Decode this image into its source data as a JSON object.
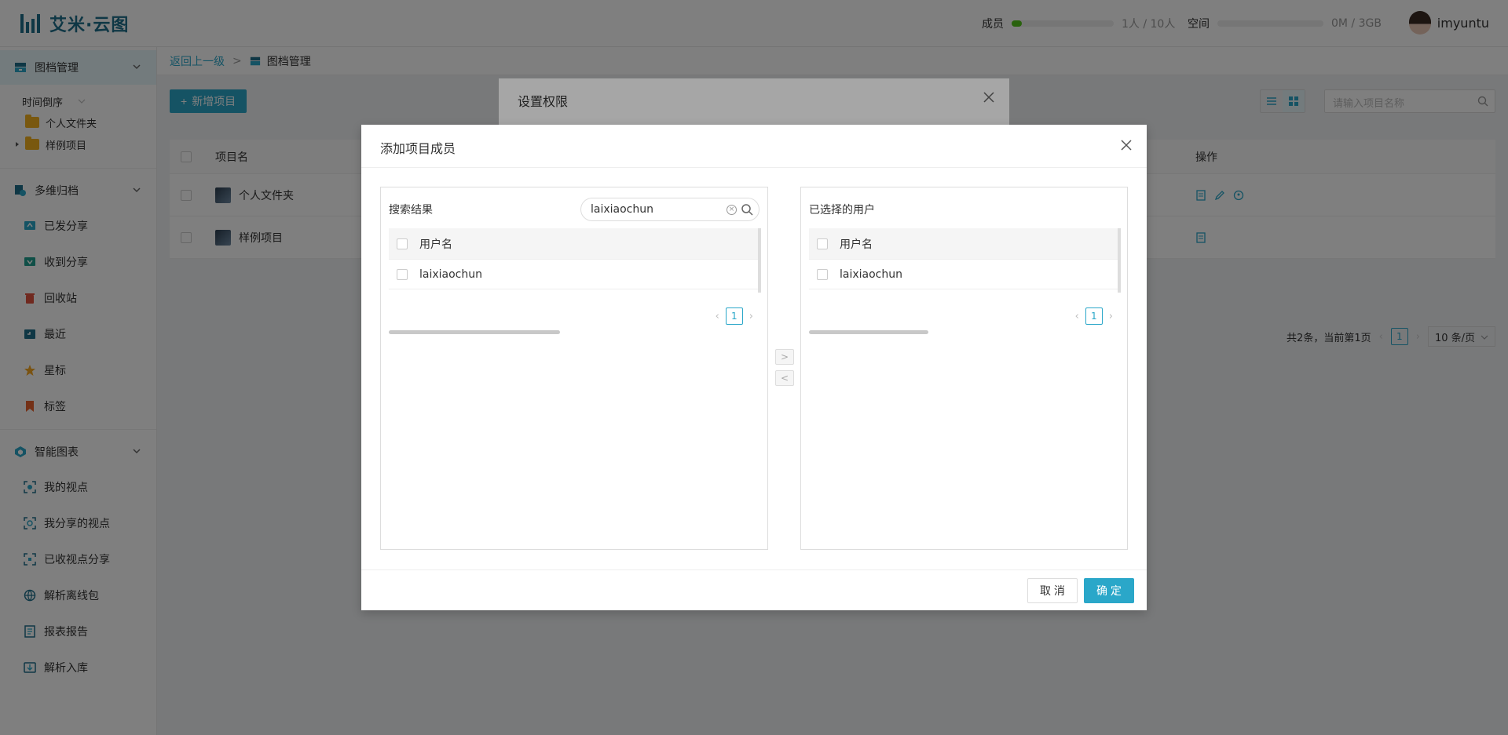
{
  "app": {
    "brand": "艾米·云图"
  },
  "header": {
    "members_label": "成员",
    "members_value": "1人 / 10人",
    "members_fraction": 0.1,
    "space_label": "空间",
    "space_value": "0M / 3GB",
    "space_fraction": 0.0,
    "username": "imyuntu"
  },
  "sidebar": {
    "group1": "图档管理",
    "sort_label": "时间倒序",
    "folders": [
      "个人文件夹",
      "样例项目"
    ],
    "group2": "多维归档",
    "archive_items": [
      "已发分享",
      "收到分享",
      "回收站",
      "最近",
      "星标",
      "标签"
    ],
    "group3": "智能图表",
    "chart_items": [
      "我的视点",
      "我分享的视点",
      "已收视点分享",
      "解析离线包",
      "报表报告",
      "解析入库"
    ]
  },
  "main": {
    "breadcrumb_back": "返回上一级",
    "breadcrumb_sep": ">",
    "breadcrumb_current": "图档管理",
    "new_button": "新增项目",
    "search_placeholder": "请输入项目名称",
    "col_name": "项目名",
    "col_ops": "操作",
    "rows": [
      "个人文件夹",
      "样例项目"
    ],
    "pager_summary": "共2条，当前第1页",
    "pager_page": "1",
    "pager_size": "10 条/页"
  },
  "dialog_back": {
    "title": "设置权限"
  },
  "dialog": {
    "title": "添加项目成员",
    "left_title": "搜索结果",
    "search_value": "laixiaochun",
    "col_username": "用户名",
    "left_rows": [
      "laixiaochun"
    ],
    "left_page": "1",
    "right_title": "已选择的用户",
    "right_rows": [
      "laixiaochun"
    ],
    "right_page": "1",
    "to_right": ">",
    "to_left": "<",
    "cancel": "取 消",
    "ok": "确 定"
  },
  "colors": {
    "accent": "#2aa7c9",
    "brand": "#1f6f8b",
    "members_bar": "#52c41a"
  }
}
